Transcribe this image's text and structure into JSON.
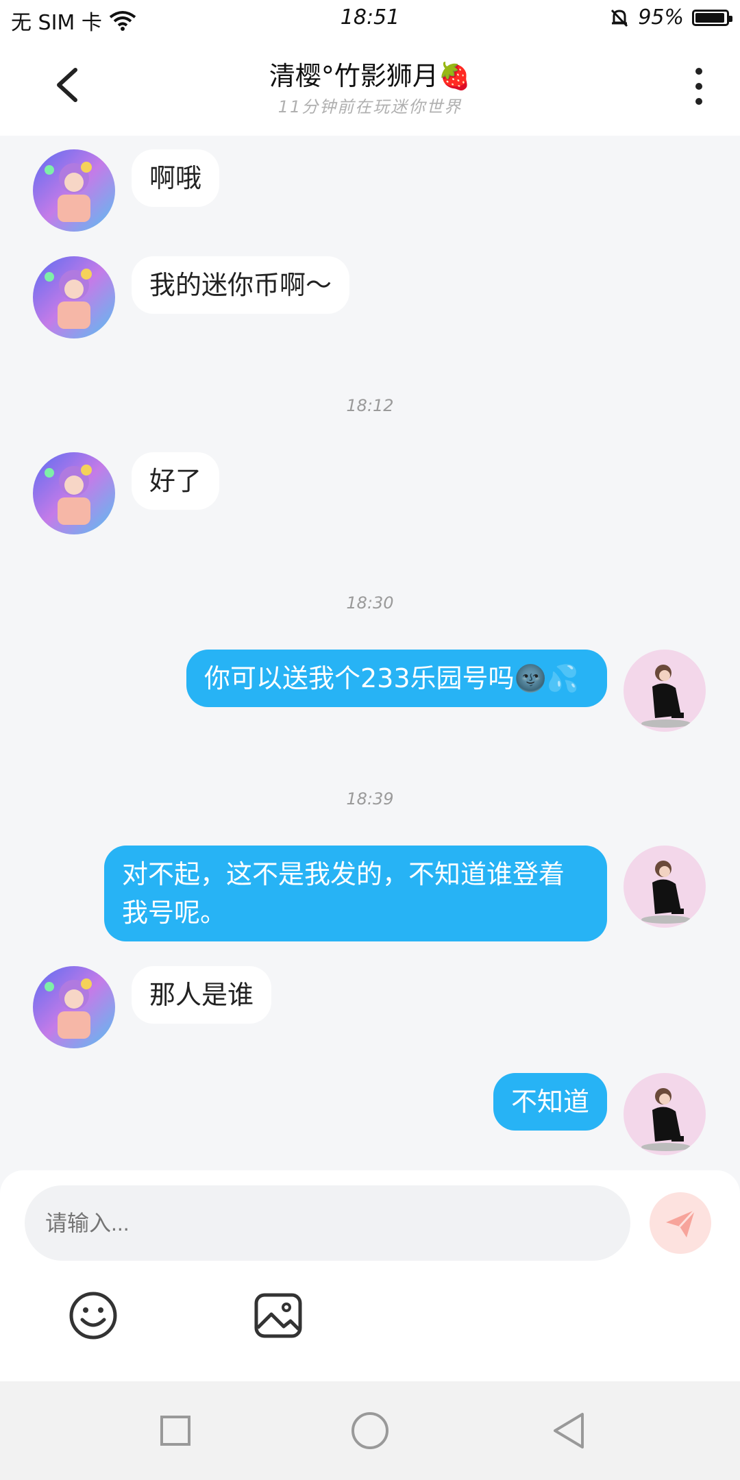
{
  "status_bar": {
    "carrier": "无 SIM 卡",
    "time": "18:51",
    "battery": "95%",
    "battery_level": 0.95
  },
  "header": {
    "title": "清樱°竹影狮月🍓",
    "subtitle": "11分钟前在玩迷你世界"
  },
  "messages": [
    {
      "side": "in",
      "text": "啊哦"
    },
    {
      "side": "in",
      "text": "我的迷你币啊～"
    },
    {
      "timestamp": "18:12"
    },
    {
      "side": "in",
      "text": "好了"
    },
    {
      "timestamp": "18:30"
    },
    {
      "side": "out",
      "text": "你可以送我个233乐园号吗🌚💦"
    },
    {
      "timestamp": "18:39"
    },
    {
      "side": "out",
      "text": "对不起，这不是我发的，不知道谁登着我号呢。"
    },
    {
      "side": "in",
      "text": "那人是谁"
    },
    {
      "side": "out",
      "text": "不知道"
    }
  ],
  "composer": {
    "placeholder": "请输入..."
  },
  "colors": {
    "outgoing_bubble": "#27b3f5",
    "incoming_bubble": "#ffffff",
    "send_button": "#fde2df",
    "send_icon": "#f7a49b"
  },
  "icons": {
    "back": "chevron-left-icon",
    "more": "more-vertical-icon",
    "send": "paper-plane-icon",
    "emoji": "smiley-icon",
    "image": "image-icon",
    "nav_recent": "square-icon",
    "nav_home": "circle-icon",
    "nav_back": "triangle-back-icon"
  }
}
